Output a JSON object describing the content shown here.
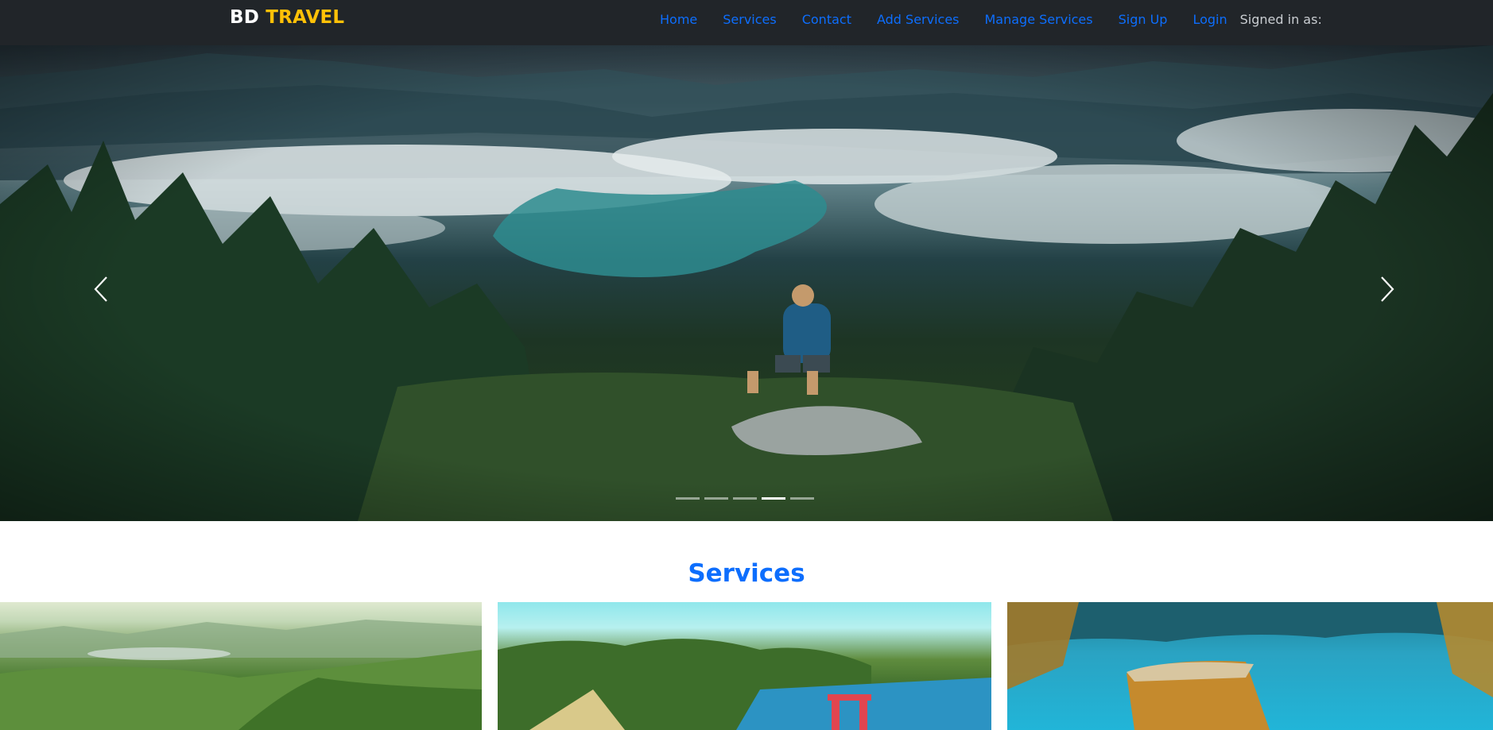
{
  "brand": {
    "part1": "BD",
    "part2": "TRAVEL"
  },
  "nav": {
    "items": [
      {
        "label": "Home"
      },
      {
        "label": "Services"
      },
      {
        "label": "Contact"
      },
      {
        "label": "Add Services"
      },
      {
        "label": "Manage Services"
      },
      {
        "label": "Sign Up"
      },
      {
        "label": "Login"
      }
    ],
    "signed_in_label": "Signed in as:"
  },
  "carousel": {
    "slide_count": 5,
    "active_index": 3,
    "prev_icon": "chevron-left-icon",
    "next_icon": "chevron-right-icon"
  },
  "services": {
    "title": "Services"
  },
  "colors": {
    "navbar_bg": "#212529",
    "link": "#0d6efd",
    "brand_accent": "#ffc107",
    "section_title": "#0d6efd"
  }
}
